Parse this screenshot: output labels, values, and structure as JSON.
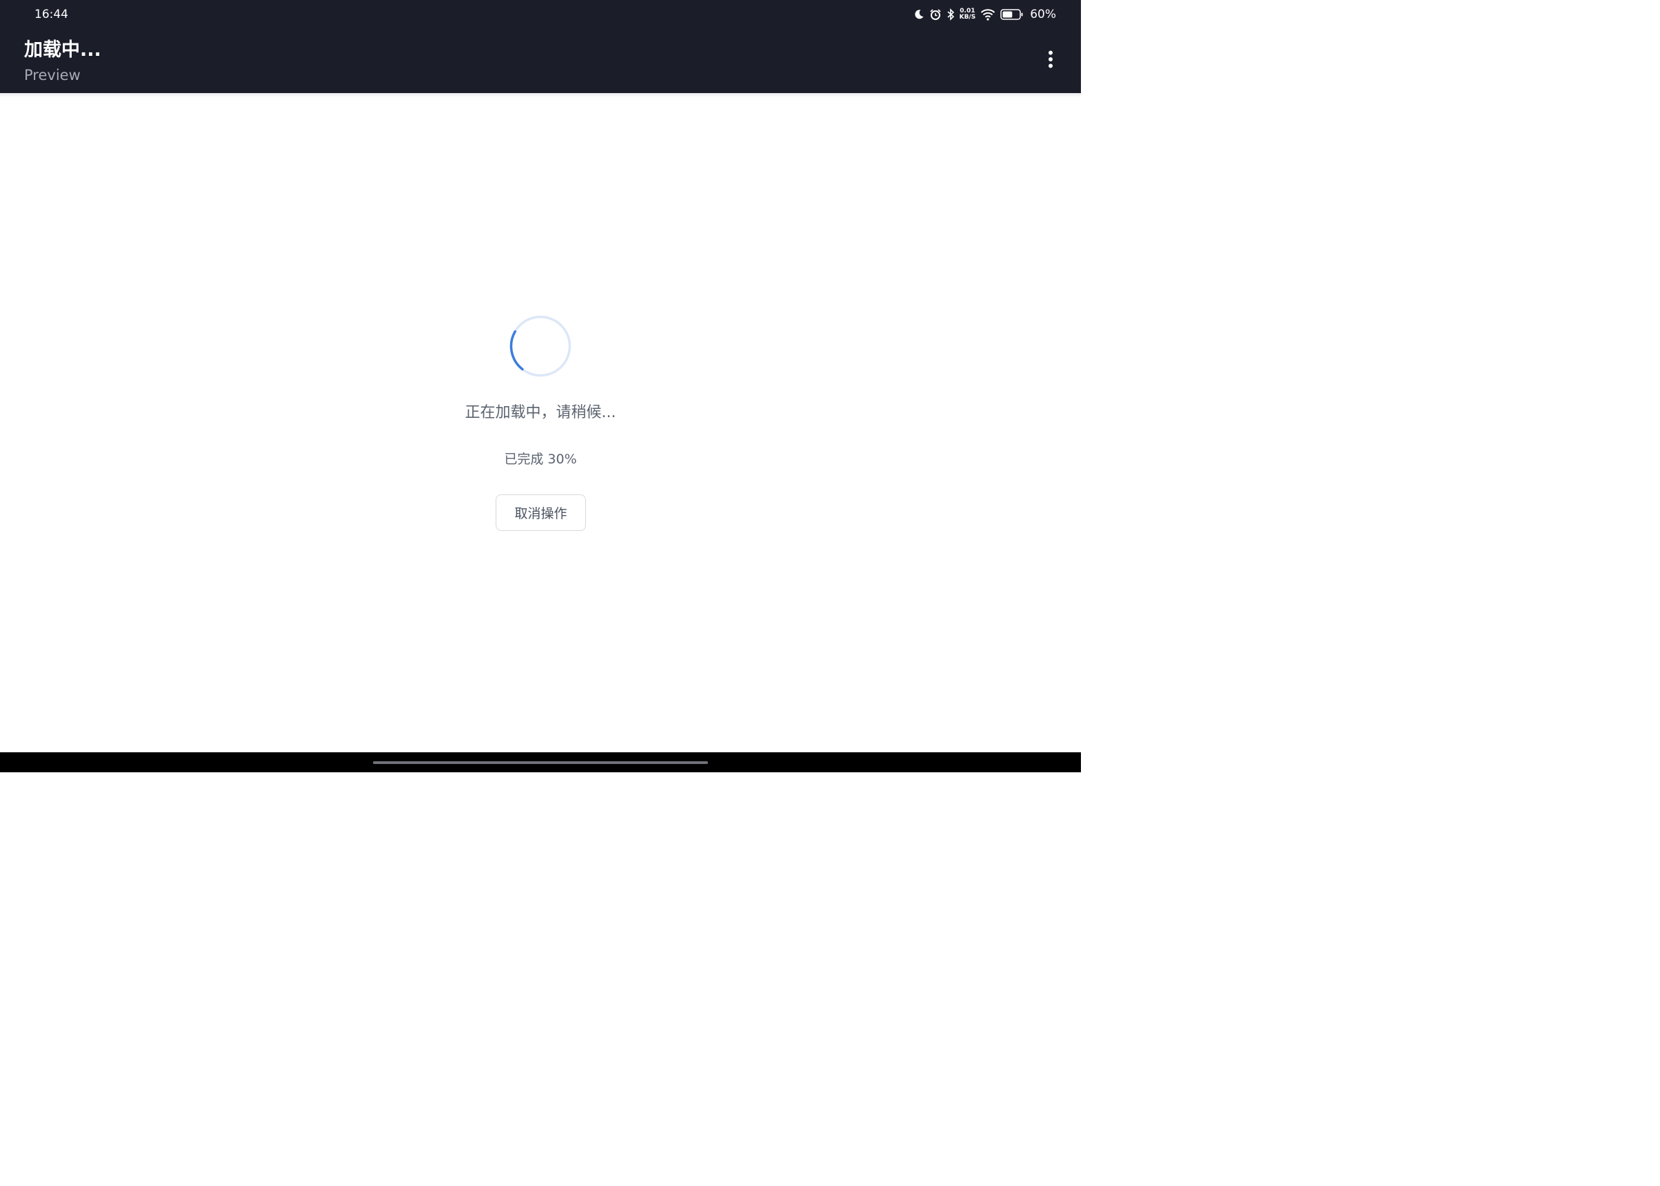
{
  "status_bar": {
    "time": "16:44",
    "net_speed_value": "0.01",
    "net_speed_unit": "KB/S",
    "battery_percent": "60%",
    "battery_level": 0.6,
    "icons": [
      "moon-icon",
      "alarm-icon",
      "bluetooth-icon",
      "wifi-icon",
      "battery-icon"
    ]
  },
  "app_bar": {
    "title": "加载中...",
    "subtitle": "Preview",
    "menu_icon": "more-vert-icon"
  },
  "loading": {
    "message": "正在加载中，请稍候...",
    "progress_text": "已完成 30%",
    "progress": 0.3,
    "cancel_label": "取消操作"
  },
  "colors": {
    "app_bar_bg": "#1b1d29",
    "spinner_accent": "#3b7ddd",
    "spinner_track": "#dce7f7",
    "text_secondary": "#5b6370"
  }
}
